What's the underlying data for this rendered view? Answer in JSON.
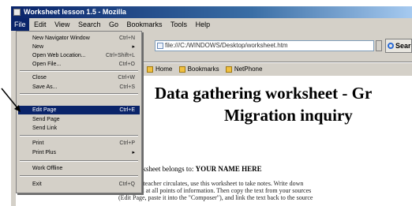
{
  "window": {
    "title": "Worksheet lesson 1.5 - Mozilla"
  },
  "menubar": {
    "items": [
      "File",
      "Edit",
      "View",
      "Search",
      "Go",
      "Bookmarks",
      "Tools",
      "Help"
    ],
    "active_index": 0
  },
  "toolbar": {
    "address_value": "file:///C:/WINDOWS/Desktop/worksheet.htm",
    "search_label": "Search"
  },
  "bookmarks": {
    "items": [
      "Home",
      "Bookmarks",
      "NetPhone"
    ]
  },
  "file_menu": {
    "items": [
      {
        "label": "New Navigator Window",
        "shortcut": "Ctrl+N"
      },
      {
        "label": "New",
        "shortcut": "",
        "submenu": true
      },
      {
        "label": "Open Web Location...",
        "shortcut": "Ctrl+Shift+L"
      },
      {
        "label": "Open File...",
        "shortcut": "Ctrl+O"
      },
      {
        "label": "Close",
        "shortcut": "Ctrl+W"
      },
      {
        "label": "Save As...",
        "shortcut": "Ctrl+S"
      },
      {
        "label": "Edit Page",
        "shortcut": "Ctrl+E",
        "selected": true
      },
      {
        "label": "Send Page",
        "shortcut": ""
      },
      {
        "label": "Send Link",
        "shortcut": ""
      },
      {
        "label": "Print",
        "shortcut": "Ctrl+P"
      },
      {
        "label": "Print Plus",
        "shortcut": "",
        "submenu": true
      },
      {
        "label": "Work Offline",
        "shortcut": ""
      },
      {
        "label": "Exit",
        "shortcut": "Ctrl+Q"
      }
    ]
  },
  "content": {
    "heading_line1": "Data gathering worksheet - Gr",
    "heading_line2": "Migration inquiry",
    "byline_prefix": "this Worksheet belongs to:",
    "byline_name": "YOUR NAME HERE",
    "instructions": [
      "while the teacher circulates, use this worksheet to take notes. Write down",
      "could find at all points of information. Then copy the text from your sources",
      "(Edit Page, paste it into the \"Composer\"), and link the text back to the source"
    ]
  }
}
